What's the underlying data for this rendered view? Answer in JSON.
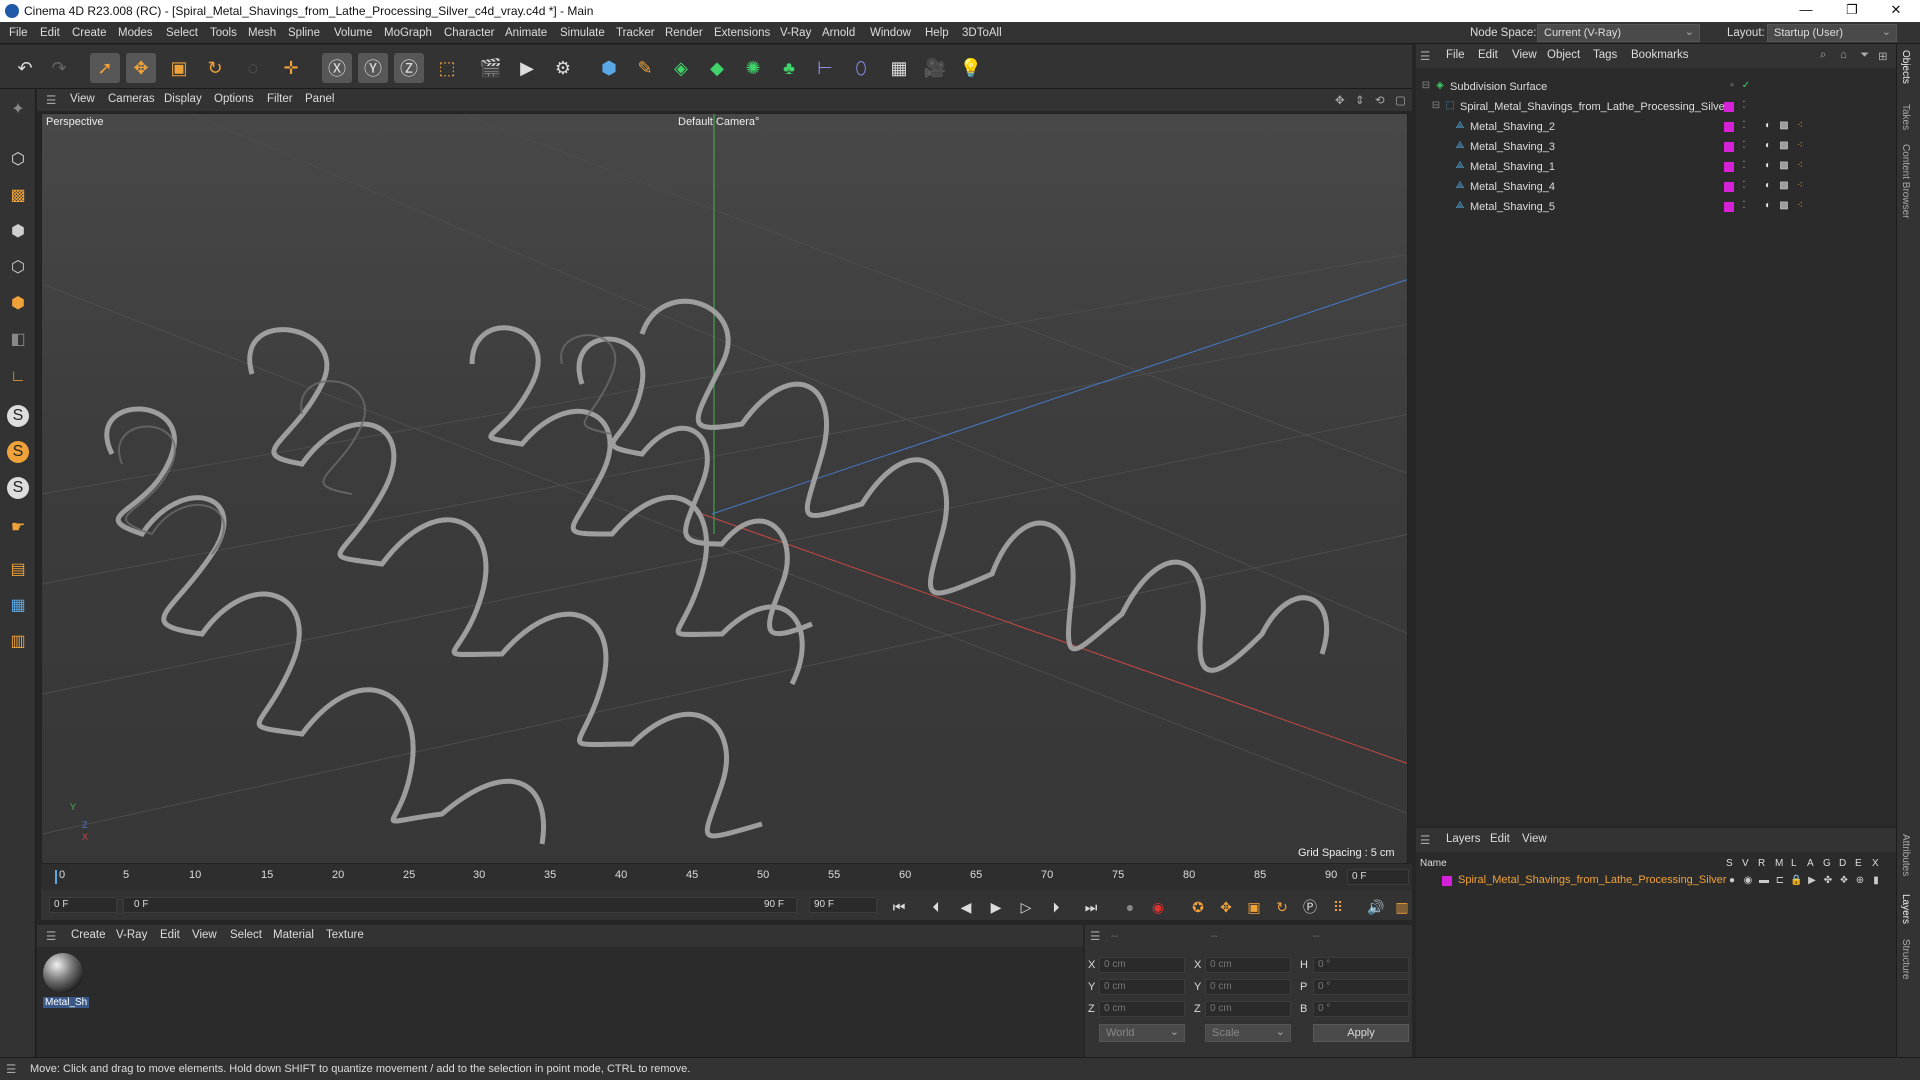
{
  "window": {
    "title": "Cinema 4D R23.008 (RC) - [Spiral_Metal_Shavings_from_Lathe_Processing_Silver_c4d_vray.c4d *] - Main",
    "controls": {
      "minimize": "—",
      "maximize": "❐",
      "close": "✕"
    }
  },
  "menu": {
    "items": [
      "File",
      "Edit",
      "Create",
      "Modes",
      "Select",
      "Tools",
      "Mesh",
      "Spline",
      "Volume",
      "MoGraph",
      "Character",
      "Animate",
      "Simulate",
      "Tracker",
      "Render",
      "Extensions",
      "V-Ray",
      "Arnold",
      "Window",
      "Help",
      "3DToAll"
    ],
    "node_space_label": "Node Space:",
    "node_space_value": "Current (V-Ray)",
    "layout_label": "Layout:",
    "layout_value": "Startup (User)"
  },
  "viewport": {
    "menu": [
      "View",
      "Cameras",
      "Display",
      "Options",
      "Filter",
      "Panel"
    ],
    "name": "Perspective",
    "camera": "Default Camera",
    "camera_suffix": "°",
    "grid_spacing": "Grid Spacing : 5 cm",
    "axis": {
      "y": "Y",
      "z": "Z",
      "x": "X"
    }
  },
  "timeline": {
    "ticks": [
      "0",
      "5",
      "10",
      "15",
      "20",
      "25",
      "30",
      "35",
      "40",
      "45",
      "50",
      "55",
      "60",
      "65",
      "70",
      "75",
      "80",
      "85",
      "90"
    ],
    "current_frame_field": "0 F",
    "start_field": "0 F",
    "range_start": "0 F",
    "range_end": "90 F",
    "end_field": "90 F"
  },
  "materials": {
    "menu": [
      "Create",
      "V-Ray",
      "Edit",
      "View",
      "Select",
      "Material",
      "Texture"
    ],
    "items": [
      {
        "name": "Metal_Sh"
      }
    ]
  },
  "coordinates": {
    "headers": [
      "--",
      "--",
      "--"
    ],
    "rows": [
      {
        "a": "X",
        "av": "0 cm",
        "b": "X",
        "bv": "0 cm",
        "c": "H",
        "cv": "0 °"
      },
      {
        "a": "Y",
        "av": "0 cm",
        "b": "Y",
        "bv": "0 cm",
        "c": "P",
        "cv": "0 °"
      },
      {
        "a": "Z",
        "av": "0 cm",
        "b": "Z",
        "bv": "0 cm",
        "c": "B",
        "cv": "0 °"
      }
    ],
    "mode1": "World",
    "mode2": "Scale",
    "apply": "Apply"
  },
  "objects": {
    "menu": [
      "File",
      "Edit",
      "View",
      "Object",
      "Tags",
      "Bookmarks"
    ],
    "tree": [
      {
        "name": "Subdivision Surface",
        "level": 0
      },
      {
        "name": "Spiral_Metal_Shavings_from_Lathe_Processing_Silver",
        "level": 1
      },
      {
        "name": "Metal_Shaving_2",
        "level": 2
      },
      {
        "name": "Metal_Shaving_3",
        "level": 2
      },
      {
        "name": "Metal_Shaving_1",
        "level": 2
      },
      {
        "name": "Metal_Shaving_4",
        "level": 2
      },
      {
        "name": "Metal_Shaving_5",
        "level": 2
      }
    ]
  },
  "layers": {
    "menu": [
      "Layers",
      "Edit",
      "View"
    ],
    "columns": [
      "Name",
      "S",
      "V",
      "R",
      "M",
      "L",
      "A",
      "G",
      "D",
      "E",
      "X"
    ],
    "items": [
      {
        "name": "Spiral_Metal_Shavings_from_Lathe_Processing_Silver"
      }
    ]
  },
  "side_tabs": [
    "Objects",
    "Takes",
    "Content Browser",
    "Attributes",
    "Layers",
    "Structure"
  ],
  "status": "Move: Click and drag to move elements. Hold down SHIFT to quantize movement / add to the selection in point mode, CTRL to remove.",
  "colors": {
    "layer_color": "#d522d8",
    "accent_orange": "#f0a23a",
    "layer_text": "#f0a23a"
  }
}
